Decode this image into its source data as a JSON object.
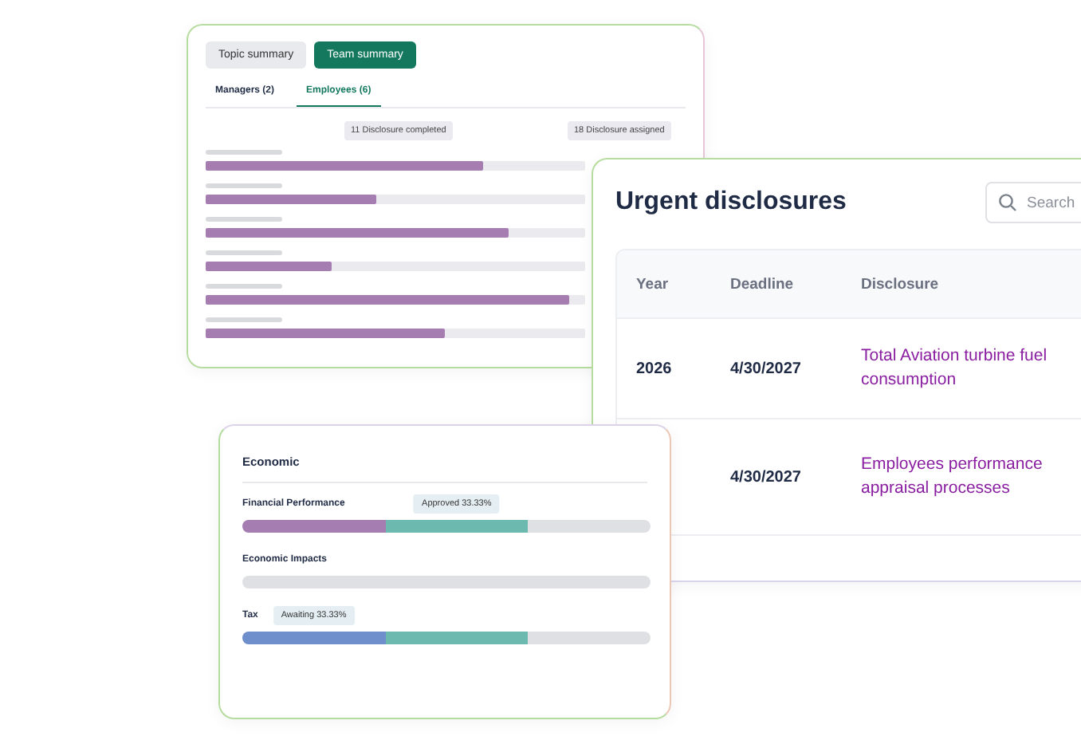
{
  "team_card": {
    "tabs": [
      {
        "label": "Topic summary",
        "selected": false
      },
      {
        "label": "Team summary",
        "selected": true
      }
    ],
    "subtabs": [
      {
        "label": "Managers (2)",
        "selected": false
      },
      {
        "label": "Employees (6)",
        "selected": true
      }
    ],
    "markers": [
      "11 Disclosure completed",
      "18 Disclosure assigned"
    ],
    "bars": [
      {
        "level": 0.73
      },
      {
        "level": 0.45
      },
      {
        "level": 0.8
      },
      {
        "level": 0.33
      },
      {
        "level": 0.96
      },
      {
        "level": 0.63
      }
    ]
  },
  "disclosures_card": {
    "title": "Urgent disclosures",
    "search": {
      "placeholder": "Search"
    },
    "columns": [
      "Year",
      "Deadline",
      "Disclosure"
    ],
    "rows": [
      {
        "year": "2026",
        "deadline": "4/30/2027",
        "disclosure": "Total Aviation turbine fuel consumption"
      },
      {
        "deadline": "4/30/2027",
        "disclosure": "Employees performance appraisal processes"
      }
    ]
  },
  "economic_card": {
    "title": "Economic",
    "items": [
      {
        "label": "Financial Performance",
        "segments": [
          {
            "color": "#a67db1"
          },
          {
            "color": "#6cb9b0",
            "tooltip": "Approved 33.33%"
          }
        ]
      },
      {
        "label": "Economic Impacts"
      },
      {
        "label": "Tax",
        "segments": [
          {
            "color": "#6f8fcc",
            "tooltip": "Awaiting 33.33%"
          },
          {
            "color": "#6cb9b0"
          }
        ]
      }
    ]
  }
}
